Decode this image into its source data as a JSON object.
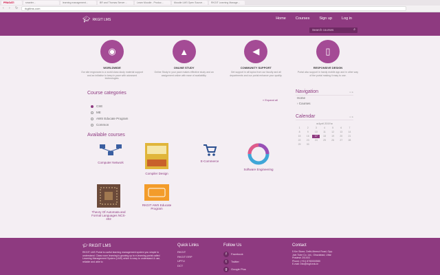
{
  "browser": {
    "tabs": [
      "PRAGATI",
      "smarter…",
      "learning management…",
      "BR and Thomas Server…",
      "Learn Moodle - Produc…",
      "Moodle LMS Open Source…",
      "RKGIT Learning Manage…"
    ],
    "url": "rkgitlms.com"
  },
  "header": {
    "logo_text": "RKGIT LMS",
    "nav": [
      "Home",
      "Courses",
      "Sign up",
      "Log in"
    ],
    "search_placeholder": "Search courses"
  },
  "features": [
    {
      "title": "WORLDWIDE",
      "text": "Our site engrosses to a world class study material support and an initiative to keep in pace with advanced technologies.",
      "icon": "globe-icon"
    },
    {
      "title": "ONLINE STUDY",
      "text": "Online Study in your pace makes effective study and an assignment online with ease of availability.",
      "icon": "graduation-cap-icon"
    },
    {
      "title": "COMMUNITY SUPPORT",
      "text": "Get support in all topics from our faculty and all departments and our portal enhance your quality.",
      "icon": "megaphone-icon"
    },
    {
      "title": "RESPONSIVE DESIGN",
      "text": "Portal also support in handy mobile app and in other way of the portal making it easy to use.",
      "icon": "mobile-icon"
    }
  ],
  "categories": {
    "title": "Course categories",
    "expand_label": "» Expand all",
    "items": [
      "CSE",
      "ME",
      "AWS Educate Program",
      "Common"
    ]
  },
  "courses": {
    "title": "Available courses",
    "items": [
      "Computer Network",
      "Compiler Design",
      "E-Commerce",
      "Software Engineering",
      "Theory Of Automata and Formal Languages NCS-402",
      "RKGIT AWS Educate Program"
    ]
  },
  "navigation": {
    "title": "Navigation",
    "links": [
      "Home",
      "› Courses"
    ]
  },
  "calendar": {
    "title": "Calendar",
    "month": "April 2019",
    "days": [
      "1",
      "2",
      "3",
      "4",
      "5",
      "6",
      "7",
      "8",
      "9",
      "10",
      "11",
      "12",
      "13",
      "14",
      "15",
      "16",
      "17",
      "18",
      "19",
      "20",
      "21",
      "22",
      "23",
      "24",
      "25",
      "26",
      "27",
      "28",
      "29",
      "30"
    ],
    "today": "17"
  },
  "footer": {
    "about_title": "RKGIT LMS",
    "about_text": "RKGIT LMS Portal is useful learning management system you simple to understand. Class room learning is growing up to e-learning portal called Learning Management System (LMS) which is easy to understand & use, reliable and able to",
    "quick_links_title": "Quick Links",
    "quick_links": [
      "RKGIT",
      "RKGIT ERP",
      "UPTU",
      "DCT"
    ],
    "follow_title": "Follow Us",
    "social": [
      {
        "label": "Facebook",
        "icon": "facebook-icon",
        "glyph": "f"
      },
      {
        "label": "Twitter",
        "icon": "twitter-icon",
        "glyph": "t"
      },
      {
        "label": "Google Plus",
        "icon": "google-plus-icon",
        "glyph": "g"
      }
    ],
    "contact_title": "Contact",
    "contact_lines": [
      "5 Km Stone, Delhi-Meerut Road, Opp.",
      "Jain Tube Co. Ltd., Ghaziabad, Uttar",
      "Pradesh 201003",
      "Phone: (+91) 8750000580",
      "E-mail: info@rkgit.edu.in"
    ]
  }
}
